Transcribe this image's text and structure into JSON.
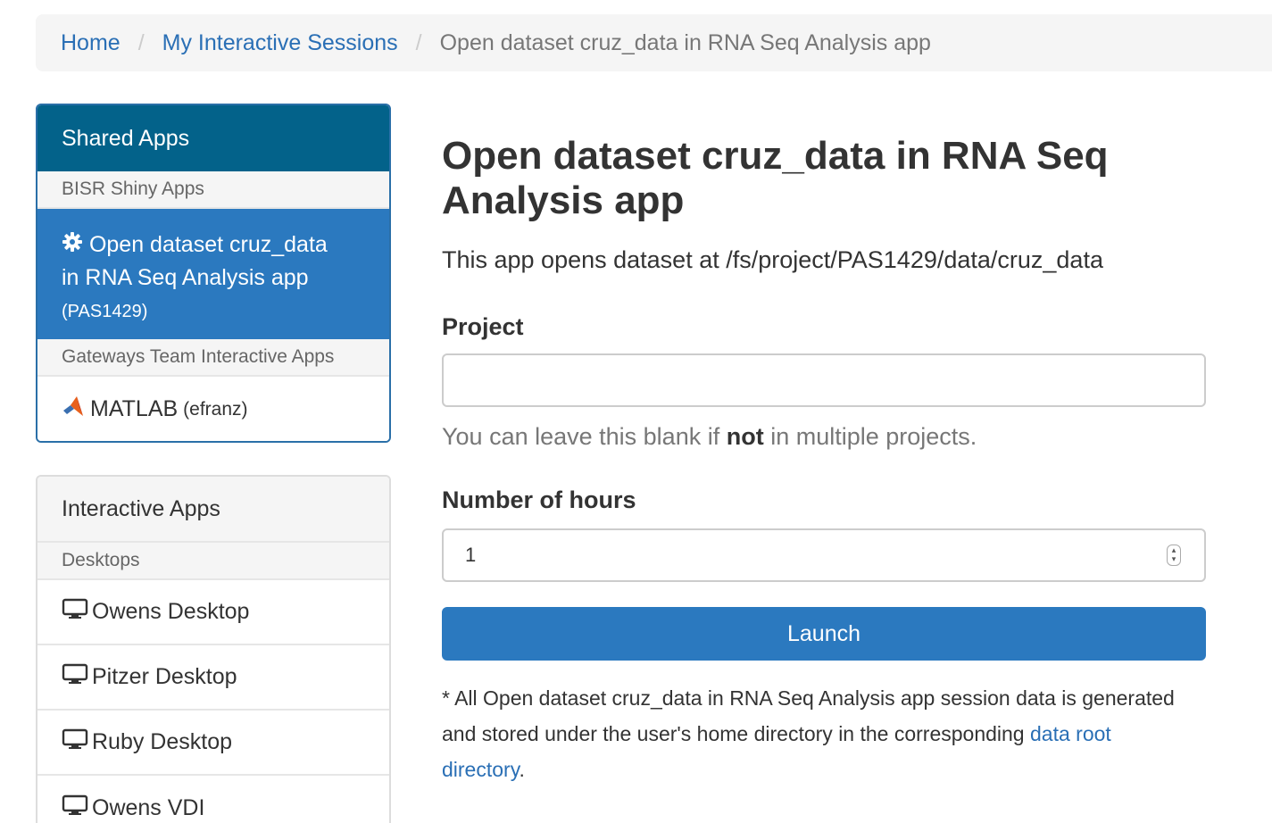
{
  "breadcrumb": {
    "home": "Home",
    "sessions": "My Interactive Sessions",
    "current": "Open dataset cruz_data in RNA Seq Analysis app",
    "separator": "/"
  },
  "shared_apps": {
    "heading": "Shared Apps",
    "groups": [
      {
        "label": "BISR Shiny Apps"
      },
      {
        "label": "Gateways Team Interactive Apps"
      }
    ],
    "active_item": {
      "line1": "Open dataset cruz_data",
      "line2": "in RNA Seq Analysis app",
      "owner": "(PAS1429)"
    },
    "matlab_item": {
      "label": "MATLAB",
      "owner": "(efranz)"
    }
  },
  "interactive_apps": {
    "heading": "Interactive Apps",
    "group": "Desktops",
    "items": [
      "Owens Desktop",
      "Pitzer Desktop",
      "Ruby Desktop",
      "Owens VDI"
    ]
  },
  "main": {
    "title_line1": "Open dataset cruz_data in RNA Seq",
    "title_line2": "Analysis app",
    "description": "This app opens dataset at /fs/project/PAS1429/data/cruz_data",
    "project_label": "Project",
    "project_value": "",
    "project_help_pre": "You can leave this blank if ",
    "project_help_bold": "not",
    "project_help_post": " in multiple projects.",
    "hours_label": "Number of hours",
    "hours_value": "1",
    "launch_label": "Launch",
    "note_text": "* All Open dataset cruz_data in RNA Seq Analysis app session data is generated and stored under the user's home directory in the corresponding ",
    "note_link": "data root directory",
    "note_end": "."
  },
  "colors": {
    "link": "#2a6fb5",
    "shared_header": "#03628a",
    "active": "#2b79bf"
  }
}
